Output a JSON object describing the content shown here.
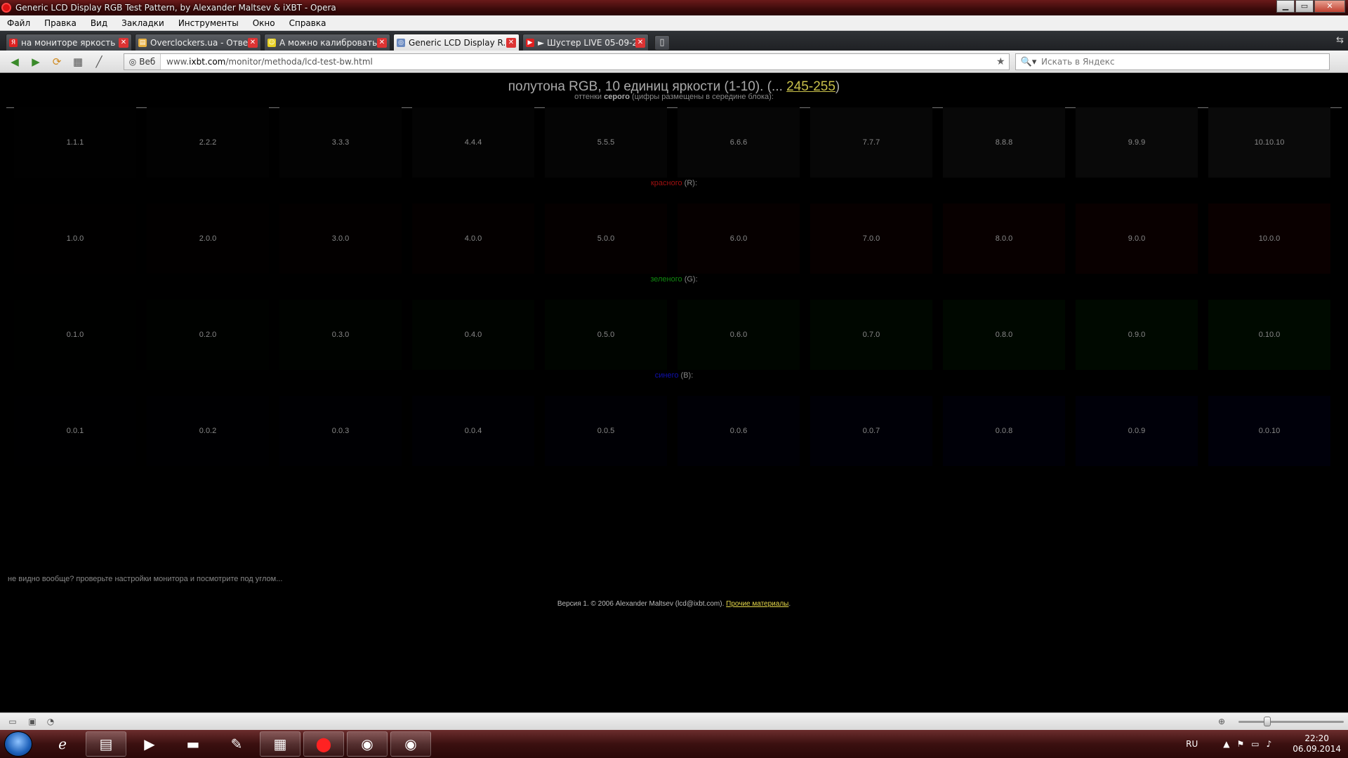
{
  "window": {
    "title": "Generic LCD Display RGB Test Pattern, by Alexander Maltsev & iXBT - Opera"
  },
  "menu": [
    "Файл",
    "Правка",
    "Вид",
    "Закладки",
    "Инструменты",
    "Окно",
    "Справка"
  ],
  "tabs": [
    {
      "label": "на мониторе яркость ...",
      "icon": "yandex-icon",
      "color": "#d22"
    },
    {
      "label": "Overclockers.ua - Отве...",
      "icon": "page-icon",
      "color": "#e8b040"
    },
    {
      "label": "А можно калибровать...",
      "icon": "smiley-icon",
      "color": "#e8d020"
    },
    {
      "label": "Generic LCD Display R...",
      "icon": "globe-icon",
      "color": "#6a8ac0",
      "active": true
    },
    {
      "label": "► Шустер LIVE 05-09-2...",
      "icon": "youtube-icon",
      "color": "#e02020"
    }
  ],
  "address": {
    "badge": "Веб",
    "url_prefix": "www.",
    "url_domain": "ixbt.com",
    "url_path": "/monitor/methoda/lcd-test-bw.html",
    "search_placeholder": "Искать в Яндекс"
  },
  "page": {
    "heading_text": "полутона RGB, 10 единиц яркости (1-10). (... ",
    "heading_link": "245-255",
    "heading_close": ")",
    "sections": [
      {
        "label_pre": "оттенки ",
        "label_bold": "серого",
        "label_post": " (цифры размещены в середине блока):",
        "label_color": "#888888",
        "cells": [
          {
            "text": "1.1.1",
            "bg": "#010101"
          },
          {
            "text": "2.2.2",
            "bg": "#020202"
          },
          {
            "text": "3.3.3",
            "bg": "#030303"
          },
          {
            "text": "4.4.4",
            "bg": "#040404"
          },
          {
            "text": "5.5.5",
            "bg": "#050505"
          },
          {
            "text": "6.6.6",
            "bg": "#060606"
          },
          {
            "text": "7.7.7",
            "bg": "#070707"
          },
          {
            "text": "8.8.8",
            "bg": "#080808"
          },
          {
            "text": "9.9.9",
            "bg": "#090909"
          },
          {
            "text": "10.10.10",
            "bg": "#0a0a0a"
          }
        ]
      },
      {
        "label_pre": "",
        "label_bold": "красного",
        "label_post": " (R):",
        "label_color": "#a01010",
        "cells": [
          {
            "text": "1.0.0",
            "bg": "#010000"
          },
          {
            "text": "2.0.0",
            "bg": "#020000"
          },
          {
            "text": "3.0.0",
            "bg": "#030000"
          },
          {
            "text": "4.0.0",
            "bg": "#040000"
          },
          {
            "text": "5.0.0",
            "bg": "#050000"
          },
          {
            "text": "6.0.0",
            "bg": "#060000"
          },
          {
            "text": "7.0.0",
            "bg": "#070000"
          },
          {
            "text": "8.0.0",
            "bg": "#080000"
          },
          {
            "text": "9.0.0",
            "bg": "#090000"
          },
          {
            "text": "10.0.0",
            "bg": "#0a0000"
          }
        ]
      },
      {
        "label_pre": "",
        "label_bold": "зеленого",
        "label_post": " (G):",
        "label_color": "#108a10",
        "cells": [
          {
            "text": "0.1.0",
            "bg": "#000100"
          },
          {
            "text": "0.2.0",
            "bg": "#000200"
          },
          {
            "text": "0.3.0",
            "bg": "#000300"
          },
          {
            "text": "0.4.0",
            "bg": "#000400"
          },
          {
            "text": "0.5.0",
            "bg": "#000500"
          },
          {
            "text": "0.6.0",
            "bg": "#000600"
          },
          {
            "text": "0.7.0",
            "bg": "#000700"
          },
          {
            "text": "0.8.0",
            "bg": "#000800"
          },
          {
            "text": "0.9.0",
            "bg": "#000900"
          },
          {
            "text": "0.10.0",
            "bg": "#000a00"
          }
        ]
      },
      {
        "label_pre": "",
        "label_bold": "синего",
        "label_post": " (B):",
        "label_color": "#1010b0",
        "cells": [
          {
            "text": "0.0.1",
            "bg": "#000001"
          },
          {
            "text": "0.0.2",
            "bg": "#000002"
          },
          {
            "text": "0.0.3",
            "bg": "#000003"
          },
          {
            "text": "0.0.4",
            "bg": "#000004"
          },
          {
            "text": "0.0.5",
            "bg": "#000005"
          },
          {
            "text": "0.0.6",
            "bg": "#000006"
          },
          {
            "text": "0.0.7",
            "bg": "#000007"
          },
          {
            "text": "0.0.8",
            "bg": "#000008"
          },
          {
            "text": "0.0.9",
            "bg": "#000009"
          },
          {
            "text": "0.0.10",
            "bg": "#00000a"
          }
        ]
      }
    ],
    "hint": "не видно вообще? проверьте настройки монитора и посмотрите под углом...",
    "footer_text": "Версия 1. © 2006 Alexander Maltsev (lcd@ixbt.com). ",
    "footer_link": "Прочие материалы",
    "footer_end": "."
  },
  "taskbar": {
    "items": [
      "ie-icon",
      "explorer-icon",
      "media-player-icon",
      "cmd-icon",
      "paint-icon",
      "task-manager-icon",
      "opera-icon",
      "webcam-icon",
      "webcam-icon-2"
    ],
    "lang": "RU",
    "time": "22:20",
    "date": "06.09.2014"
  }
}
